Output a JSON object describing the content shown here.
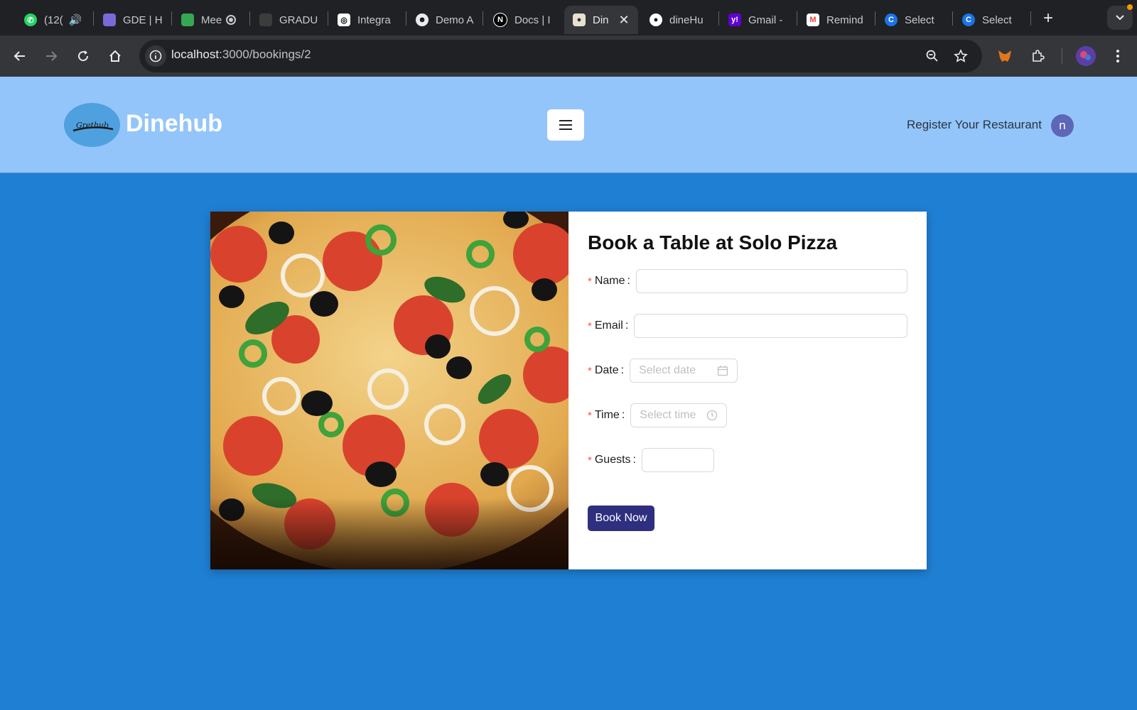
{
  "browser": {
    "tabs": [
      {
        "label": "(12(",
        "icon": "whatsapp-icon"
      },
      {
        "label": "GDE | H",
        "icon": "gde-icon"
      },
      {
        "label": "Mee",
        "icon": "meet-icon"
      },
      {
        "label": "GRADU",
        "icon": "gradu-icon"
      },
      {
        "label": "Integra",
        "icon": "openai-icon"
      },
      {
        "label": "Demo A",
        "icon": "demo-icon"
      },
      {
        "label": "Docs | I",
        "icon": "notion-icon"
      },
      {
        "label": "Din",
        "icon": "dinehub-favicon"
      },
      {
        "label": "dineHu",
        "icon": "github-icon"
      },
      {
        "label": "Gmail -",
        "icon": "yahoo-icon"
      },
      {
        "label": "Remind",
        "icon": "gmail-icon"
      },
      {
        "label": "Select",
        "icon": "select-icon"
      },
      {
        "label": "Select",
        "icon": "select-icon"
      }
    ],
    "url_host": "localhost",
    "url_path": ":3000/bookings/2"
  },
  "header": {
    "brand": "Dinehub",
    "logo_text": "Grethub",
    "register_label": "Register Your Restaurant",
    "avatar_letter": "n"
  },
  "booking": {
    "title": "Book a Table at Solo Pizza",
    "fields": {
      "name_label": "Name",
      "name_value": "",
      "email_label": "Email",
      "email_value": "",
      "date_label": "Date",
      "date_placeholder": "Select date",
      "time_label": "Time",
      "time_placeholder": "Select time",
      "guests_label": "Guests",
      "guests_value": ""
    },
    "submit_label": "Book Now"
  },
  "colors": {
    "page_background": "#1f7fd3",
    "header_background": "#93c5fa",
    "button_background": "#2f2f7f",
    "required_star": "#ff4d4f"
  }
}
